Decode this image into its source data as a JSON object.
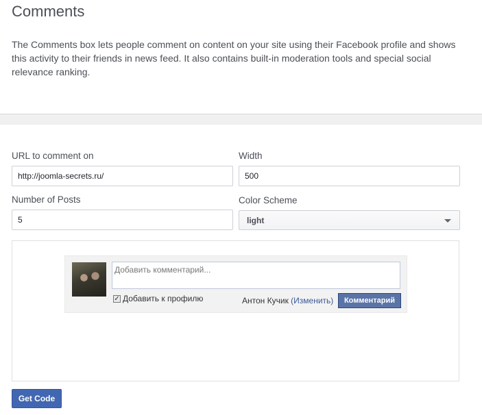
{
  "header": {
    "title": "Comments",
    "description": "The Comments box lets people comment on content on your site using their Facebook profile and shows this activity to their friends in news feed. It also contains built-in moderation tools and special social relevance ranking."
  },
  "form": {
    "url_label": "URL to comment on",
    "url_value": "http://joomla-secrets.ru/",
    "width_label": "Width",
    "width_value": "500",
    "posts_label": "Number of Posts",
    "posts_value": "5",
    "scheme_label": "Color Scheme",
    "scheme_value": "light"
  },
  "preview": {
    "placeholder": "Добавить комментарий...",
    "add_to_profile_label": "Добавить к профилю",
    "add_to_profile_checked": true,
    "author_name": "Антон Кучик",
    "change_link": "(Изменить)",
    "submit_label": "Комментарий"
  },
  "actions": {
    "get_code_label": "Get Code"
  }
}
